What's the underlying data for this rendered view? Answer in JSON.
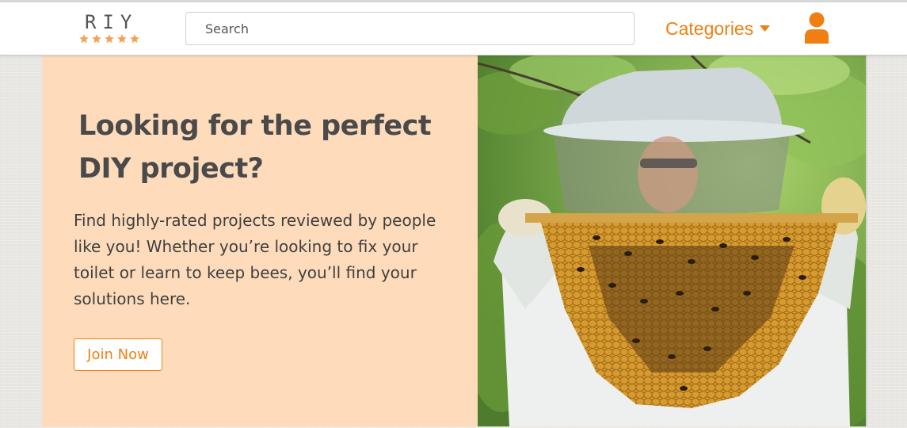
{
  "brand": {
    "logo_text": "RIY",
    "star_count": 5,
    "star_color": "#f4a25b"
  },
  "header": {
    "search_placeholder": "Search",
    "categories_label": "Categories",
    "accent_color": "#ef7f12",
    "icons": [
      "chevron-down-icon",
      "user-icon"
    ]
  },
  "hero": {
    "title": "Looking for the perfect DIY project?",
    "body": "Find highly-rated projects reviewed by people like you! Whether you’re looking to fix your toilet or learn to keep bees, you’ll find your solutions here.",
    "join_label": "Join Now",
    "panel_color": "#fedcbb"
  }
}
